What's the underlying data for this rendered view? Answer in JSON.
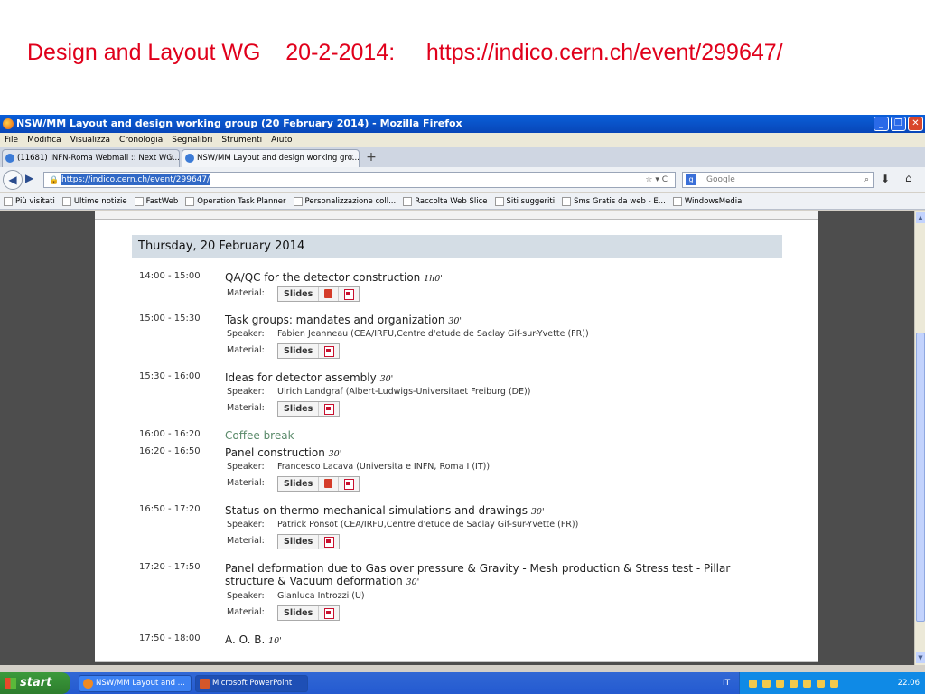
{
  "slide": {
    "title": "Design and Layout WG    20-2-2014:     https://indico.cern.ch/event/299647/"
  },
  "window": {
    "title": "NSW/MM Layout and design working group (20 February 2014) - Mozilla Firefox",
    "menu": [
      "File",
      "Modifica",
      "Visualizza",
      "Cronologia",
      "Segnalibri",
      "Strumenti",
      "Aiuto"
    ],
    "tabs": [
      {
        "label": "(11681) INFN-Roma Webmail :: Next WG..."
      },
      {
        "label": "NSW/MM Layout and design working gro..."
      }
    ],
    "url": "https://indico.cern.ch/event/299647/",
    "search_placeholder": "Google",
    "bookmarks": [
      "Più visitati",
      "Ultime notizie",
      "FastWeb",
      "Operation Task Planner",
      "Personalizzazione coll...",
      "Raccolta Web Slice",
      "Siti suggeriti",
      "Sms Gratis da web - E...",
      "WindowsMedia"
    ]
  },
  "agenda": {
    "day": "Thursday, 20 February 2014",
    "labels": {
      "material": "Material:",
      "speaker": "Speaker:",
      "slides": "Slides"
    },
    "items": [
      {
        "time": "14:00 - 15:00",
        "title": "QA/QC for the detector construction",
        "duration": "1h0'"
      },
      {
        "time": "15:00 - 15:30",
        "title": "Task groups: mandates and organization",
        "duration": "30'",
        "speaker": "Fabien Jeanneau (CEA/IRFU,Centre d'etude de Saclay Gif-sur-Yvette (FR))"
      },
      {
        "time": "15:30 - 16:00",
        "title": "Ideas for detector assembly",
        "duration": "30'",
        "speaker": "Ulrich Landgraf (Albert-Ludwigs-Universitaet Freiburg (DE))"
      },
      {
        "time": "16:00 - 16:20",
        "title": "Coffee break"
      },
      {
        "time": "16:20 - 16:50",
        "title": "Panel construction",
        "duration": "30'",
        "speaker": "Francesco Lacava (Universita e INFN, Roma I (IT))"
      },
      {
        "time": "16:50 - 17:20",
        "title": "Status on thermo-mechanical simulations and drawings",
        "duration": "30'",
        "speaker": "Patrick Ponsot (CEA/IRFU,Centre d'etude de Saclay Gif-sur-Yvette (FR))"
      },
      {
        "time": "17:20 - 17:50",
        "title": "Panel deformation due to Gas over pressure & Gravity - Mesh production & Stress test - Pillar structure & Vacuum deformation",
        "duration": "30'",
        "speaker": "Gianluca Introzzi (U)"
      },
      {
        "time": "17:50 - 18:00",
        "title": "A. O. B.",
        "duration": "10'"
      }
    ]
  },
  "taskbar": {
    "start": "start",
    "tasks": [
      "NSW/MM Layout and ...",
      "Microsoft PowerPoint"
    ],
    "lang": "IT",
    "clock": "22.06"
  }
}
